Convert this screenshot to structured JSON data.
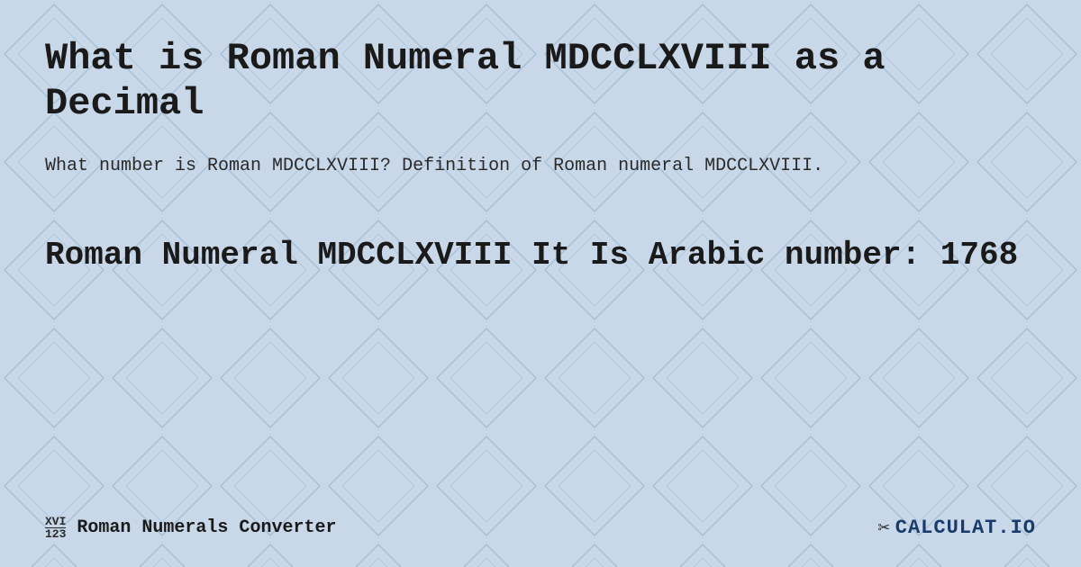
{
  "background": {
    "color": "#c8d8e8",
    "pattern": "diamond-grid"
  },
  "main_title": "What is Roman Numeral MDCCLXVIII as a Decimal",
  "description": "What number is Roman MDCCLXVIII? Definition of Roman numeral MDCCLXVIII.",
  "result": {
    "title": "Roman Numeral MDCCLXVIII It Is  Arabic number: 1768"
  },
  "footer": {
    "icon_top": "XVI",
    "icon_bottom": "123",
    "converter_label": "Roman Numerals Converter",
    "logo_text": "✁ CALCULAT.IO"
  }
}
